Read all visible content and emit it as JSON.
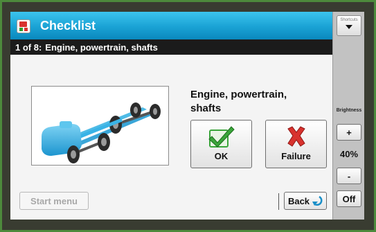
{
  "header": {
    "title": "Checklist",
    "progress": "1 of 8:",
    "section": "Engine, powertrain, shafts"
  },
  "item": {
    "title_line1": "Engine, powertrain,",
    "title_line2": "shafts",
    "image_icon": "chassis-powertrain-illustration"
  },
  "actions": {
    "ok_label": "OK",
    "failure_label": "Failure",
    "start_label": "Start menu",
    "back_label": "Back"
  },
  "sidebar": {
    "shortcuts_label": "Shortcuts",
    "brightness_label": "Brightness",
    "brightness_value": "40%",
    "plus_label": "+",
    "minus_label": "-",
    "off_label": "Off"
  },
  "colors": {
    "title_bar": "#1aa2d4",
    "ok_check": "#3aa53a",
    "failure_x": "#d8322e",
    "chassis": "#39b3e6"
  }
}
